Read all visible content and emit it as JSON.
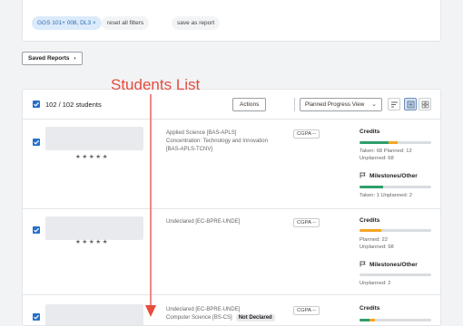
{
  "filters": {
    "chip_label": "GGS 101+ 008, DL3",
    "chip_close": "×",
    "reset_label": "reset all filters",
    "save_label": "save as report"
  },
  "saved_reports": {
    "label": "Saved Reports",
    "chevron": "›"
  },
  "annotation": {
    "title": "Students List"
  },
  "list_header": {
    "count": "102 / 102 students",
    "actions_label": "Actions",
    "view_select": "Planned Progress View",
    "chevron": "⌄"
  },
  "students": [
    {
      "stars": "★★★★★",
      "program_lines": [
        "Applied Science [BAS-APLS]",
        "Concentration: Technology and Innovation",
        "[BAS-APLS-TCNV]"
      ],
      "cgpa": "CGPA --",
      "credits_title": "Credits",
      "credits_taken_frac": 0.41,
      "credits_planned_frac": 0.12,
      "credits_line1": "Taken: 68     Planned: 12",
      "credits_line2": "Unplanned: 68",
      "milestones_title": "Milestones/Other",
      "milestones_taken_frac": 0.33,
      "milestones_line": "Taken: 1     Unplanned: 2"
    },
    {
      "stars": "★★★★★",
      "program_lines": [
        "Undeclared [EC-BPRE-UNDE]"
      ],
      "cgpa": "CGPA --",
      "credits_title": "Credits",
      "credits_taken_frac": 0.0,
      "credits_planned_frac": 0.3,
      "credits_line1": "Planned: 22",
      "credits_line2": "Unplanned: 98",
      "milestones_title": "Milestones/Other",
      "milestones_taken_frac": 0.0,
      "milestones_line": "Unplanned: 2"
    },
    {
      "program_lines": [
        "Undeclared [EC-BPRE-UNDE]",
        "Computer Science [BS-CS]"
      ],
      "not_declared": "Not Declared",
      "cgpa": "CGPA --",
      "credits_title": "Credits",
      "credits_taken_frac": 0.14,
      "credits_planned_frac": 0.08
    }
  ],
  "colors": {
    "accent": "#2670c8",
    "taken": "#2e9e6b",
    "planned": "#f5a623",
    "annotation": "#e74c3c"
  }
}
